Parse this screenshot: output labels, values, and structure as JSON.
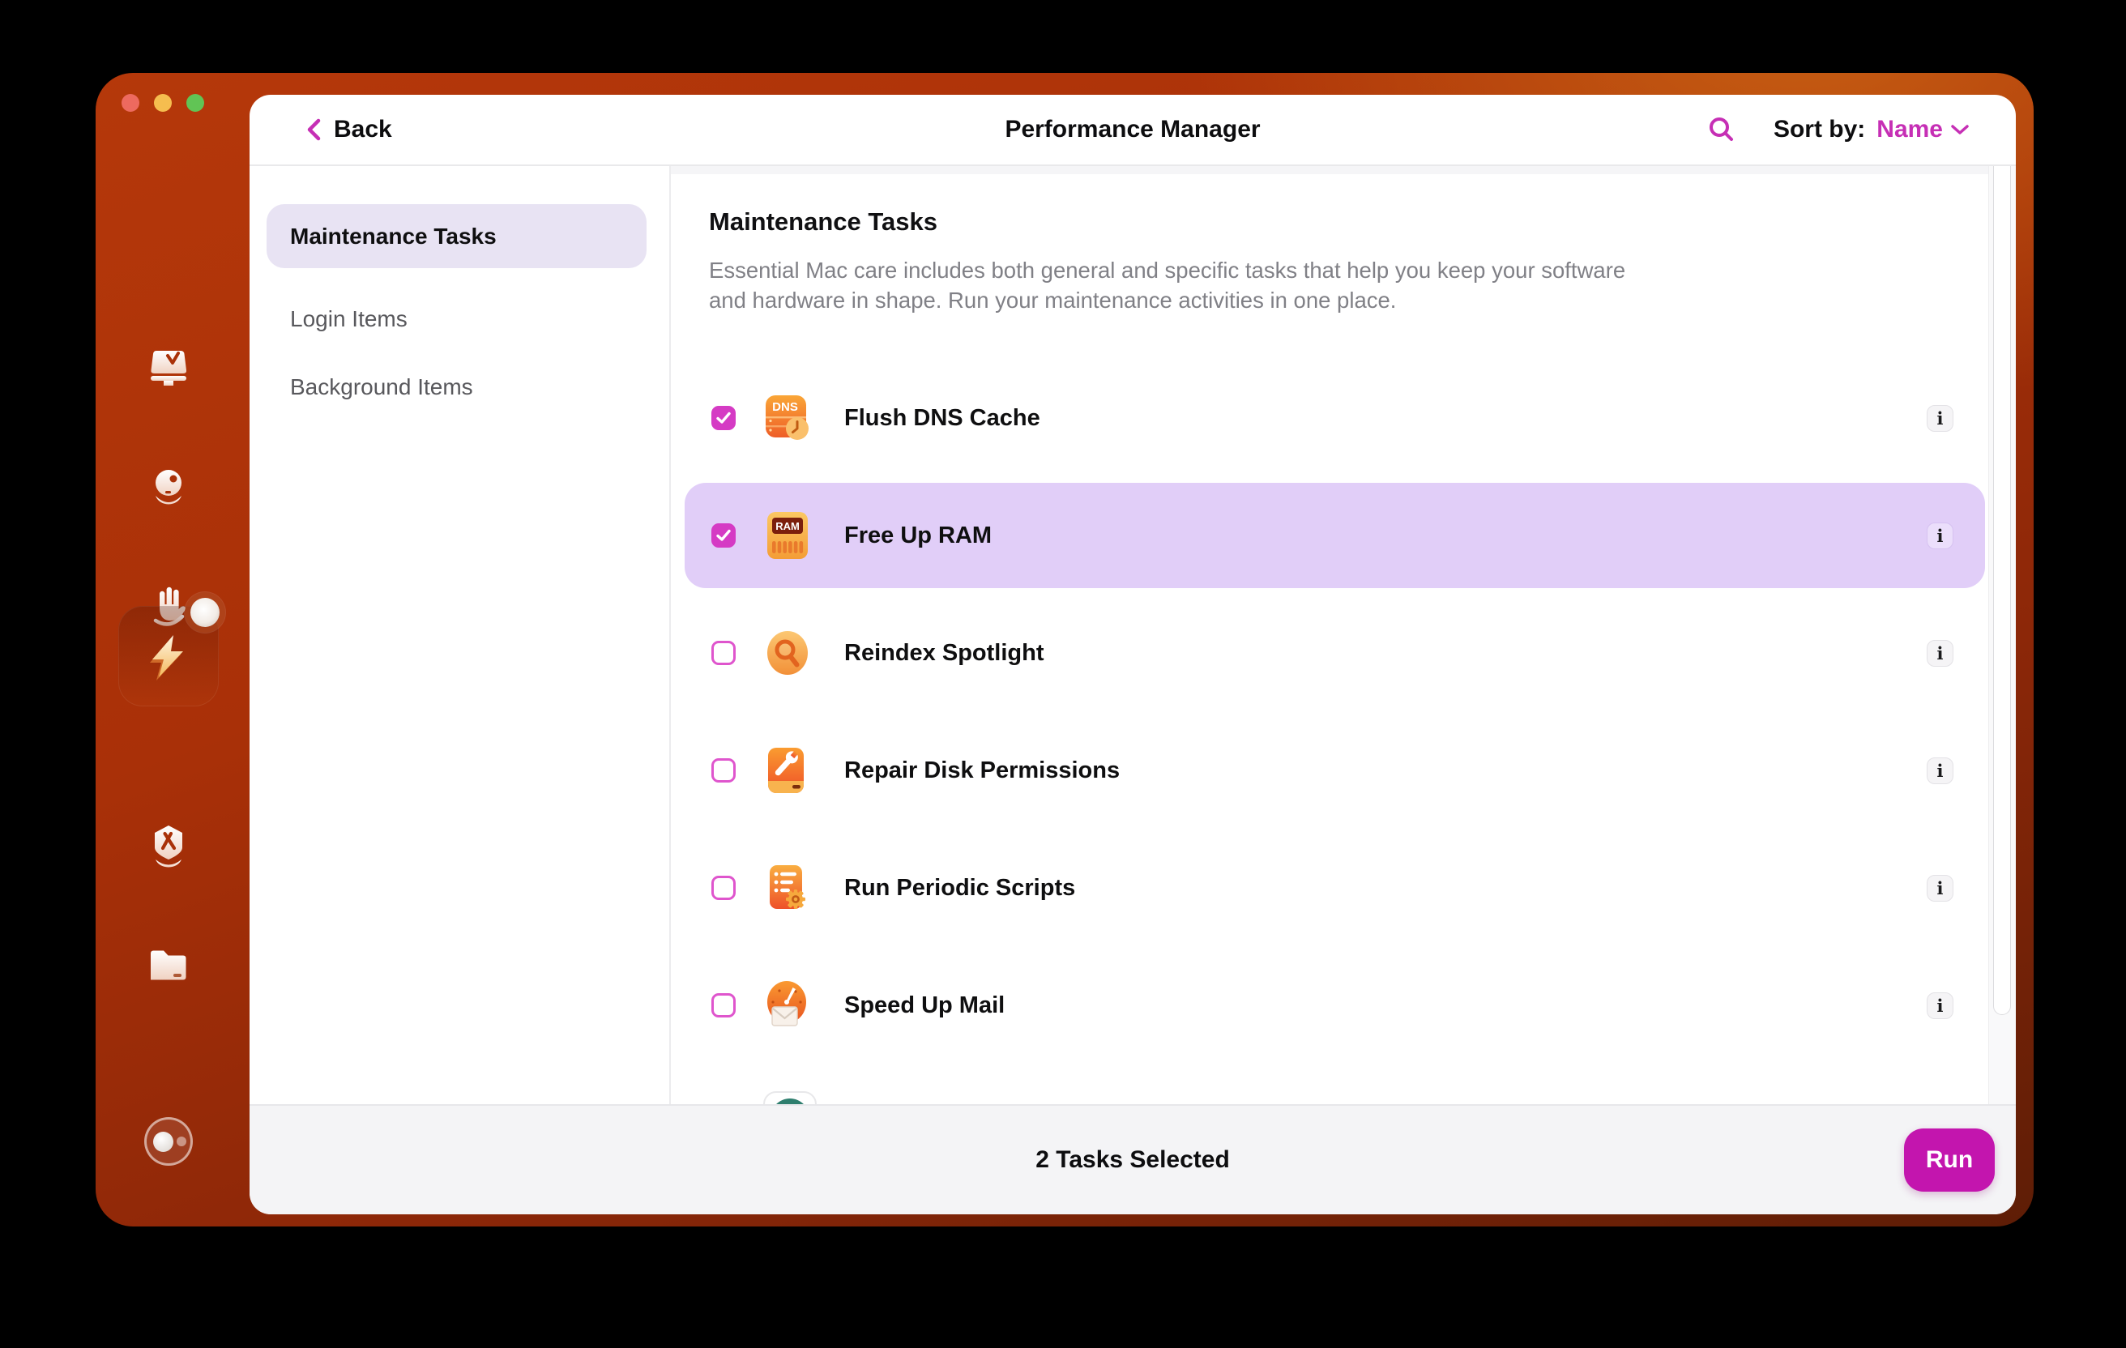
{
  "window": {
    "traffic_lights": [
      "close",
      "minimize",
      "zoom"
    ],
    "header": {
      "back_label": "Back",
      "title": "Performance Manager",
      "sort_by_label": "Sort by:",
      "sort_value": "Name"
    },
    "nav": {
      "items": [
        {
          "label": "Maintenance Tasks",
          "selected": true
        },
        {
          "label": "Login Items",
          "selected": false
        },
        {
          "label": "Background Items",
          "selected": false
        }
      ]
    },
    "content": {
      "heading": "Maintenance Tasks",
      "description": "Essential Mac care includes both general and specific tasks that help you keep your software and hardware in shape. Run your maintenance activities in one place.",
      "info_glyph": "i",
      "tasks": [
        {
          "label": "Flush DNS Cache",
          "checked": true,
          "highlighted": false,
          "icon": "dns-cache-icon"
        },
        {
          "label": "Free Up RAM",
          "checked": true,
          "highlighted": true,
          "icon": "ram-icon"
        },
        {
          "label": "Reindex Spotlight",
          "checked": false,
          "highlighted": false,
          "icon": "spotlight-icon"
        },
        {
          "label": "Repair Disk Permissions",
          "checked": false,
          "highlighted": false,
          "icon": "disk-permissions-icon"
        },
        {
          "label": "Run Periodic Scripts",
          "checked": false,
          "highlighted": false,
          "icon": "periodic-scripts-icon"
        },
        {
          "label": "Speed Up Mail",
          "checked": false,
          "highlighted": false,
          "icon": "mail-speed-icon"
        }
      ]
    },
    "footer": {
      "status": "2 Tasks Selected",
      "run_label": "Run"
    },
    "app_sidebar": {
      "modules": [
        "cleanup",
        "smart-scan",
        "privacy",
        "performance",
        "applications",
        "files",
        "assistant"
      ],
      "selected_module": "performance"
    }
  },
  "colors": {
    "accent_magenta": "#c62fb5",
    "run_button": "#c315ae",
    "checkbox_checked": "#d53bc4",
    "highlight_row": "#e1cef8",
    "nav_selected_pill": "#e8e3f3",
    "frame_orange_top": "#b5380a",
    "frame_orange_bottom": "#5e1d06",
    "footer_bg": "#f4f4f6",
    "partial_icon_teal": "#2e7e6e"
  }
}
